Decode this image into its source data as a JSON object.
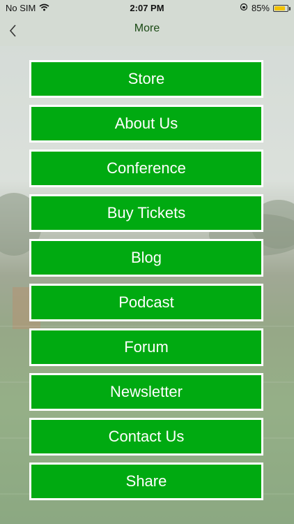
{
  "status_bar": {
    "carrier": "No SIM",
    "time": "2:07 PM",
    "battery_percent": "85%",
    "battery_level": 0.85,
    "icons": [
      "wifi-icon",
      "rotation-lock-icon",
      "battery-icon"
    ]
  },
  "nav": {
    "title": "More",
    "back_icon": "chevron-left-icon"
  },
  "colors": {
    "button_green": "#00aa11",
    "button_border": "#ffffff",
    "nav_background": "#d4dbd3",
    "title_color": "#1a4a14"
  },
  "menu": {
    "items": [
      {
        "label": "Store"
      },
      {
        "label": "About Us"
      },
      {
        "label": "Conference"
      },
      {
        "label": "Buy Tickets"
      },
      {
        "label": "Blog"
      },
      {
        "label": "Podcast"
      },
      {
        "label": "Forum"
      },
      {
        "label": "Newsletter"
      },
      {
        "label": "Contact Us"
      },
      {
        "label": "Share"
      }
    ]
  }
}
